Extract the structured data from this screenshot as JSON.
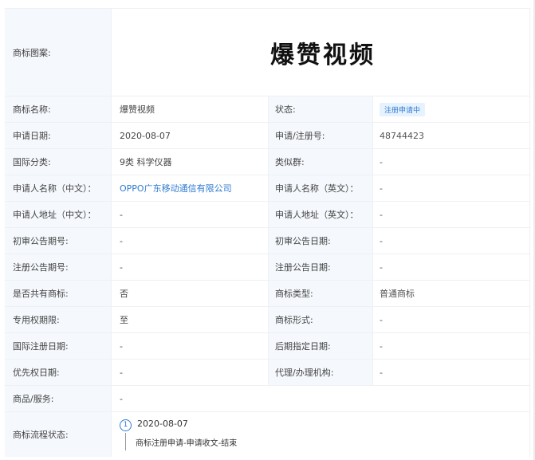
{
  "header": {
    "label": "商标图案:",
    "image_text": "爆赞视频"
  },
  "rows": [
    {
      "l1": "商标名称:",
      "v1": "爆赞视频",
      "l2": "状态:",
      "v2": "注册申请中"
    },
    {
      "l1": "申请日期:",
      "v1": "2020-08-07",
      "l2": "申请/注册号:",
      "v2": "48744423"
    },
    {
      "l1": "国际分类:",
      "v1": "9类 科学仪器",
      "l2": "类似群:",
      "v2": "-"
    },
    {
      "l1": "申请人名称（中文）：",
      "v1": "OPPO广东移动通信有限公司",
      "l2": "申请人名称（英文）：",
      "v2": "-"
    },
    {
      "l1": "申请人地址（中文）：",
      "v1": "-",
      "l2": "申请人地址（英文）：",
      "v2": "-"
    },
    {
      "l1": "初审公告期号:",
      "v1": "-",
      "l2": "初审公告日期:",
      "v2": "-"
    },
    {
      "l1": "注册公告期号:",
      "v1": "-",
      "l2": "注册公告日期:",
      "v2": "-"
    },
    {
      "l1": "是否共有商标:",
      "v1": "否",
      "l2": "商标类型:",
      "v2": "普通商标"
    },
    {
      "l1": "专用权期限:",
      "v1": "至",
      "l2": "商标形式:",
      "v2": "-"
    },
    {
      "l1": "国际注册日期:",
      "v1": "-",
      "l2": "后期指定日期:",
      "v2": "-"
    },
    {
      "l1": "优先权日期:",
      "v1": "-",
      "l2": "代理/办理机构:",
      "v2": "-"
    }
  ],
  "goods": {
    "label": "商品/服务:",
    "value": "-"
  },
  "flow": {
    "label": "商标流程状态:",
    "steps": [
      {
        "number": "1",
        "date": "2020-08-07",
        "desc": "商标注册申请-申请收文-结束"
      }
    ]
  },
  "colors": {
    "label_bg": "#f5f8fc",
    "link": "#2f7bd2",
    "badge_bg": "#e6f2fd",
    "border": "#eef0f4"
  }
}
